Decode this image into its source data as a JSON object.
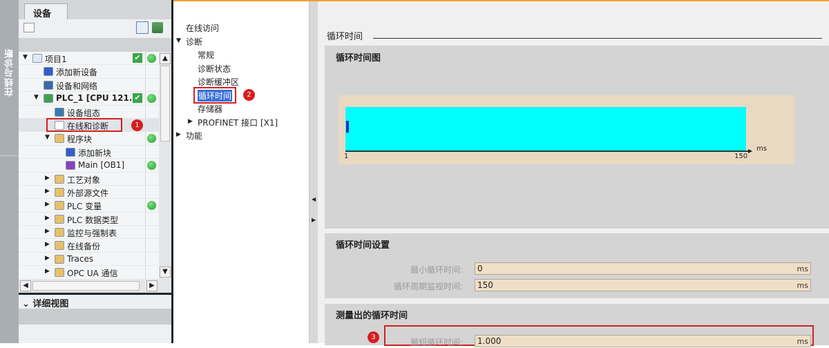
{
  "side_strip": {
    "label": "在线与诊断"
  },
  "project_panel": {
    "tab": "设备",
    "tree": [
      {
        "label": "项目1",
        "indent": 0,
        "expander": "▼",
        "icon_color": "#dfe8f4",
        "check": true,
        "status": true
      },
      {
        "label": "添加新设备",
        "indent": 1,
        "icon_color": "#3060c8"
      },
      {
        "label": "设备和网络",
        "indent": 1,
        "icon_color": "#3a6aa8"
      },
      {
        "label": "PLC_1 [CPU 121...",
        "indent": 1,
        "expander": "▼",
        "icon_color": "#40a050",
        "check": true,
        "status": true,
        "bold": true
      },
      {
        "label": "设备组态",
        "indent": 2,
        "icon_color": "#3a7ab0"
      },
      {
        "label": "在线和诊断",
        "indent": 2,
        "icon_color": "#ffffff",
        "highlight": true,
        "badge": "1"
      },
      {
        "label": "程序块",
        "indent": 2,
        "expander": "▼",
        "icon_color": "#e8c068",
        "status": true
      },
      {
        "label": "添加新块",
        "indent": 3,
        "icon_color": "#3060c8"
      },
      {
        "label": "Main [OB1]",
        "indent": 3,
        "icon_color": "#8a40c0",
        "status": true
      },
      {
        "label": "工艺对象",
        "indent": 2,
        "expander": "▶",
        "icon_color": "#e8c068"
      },
      {
        "label": "外部源文件",
        "indent": 2,
        "expander": "▶",
        "icon_color": "#e8c068"
      },
      {
        "label": "PLC 变量",
        "indent": 2,
        "expander": "▶",
        "icon_color": "#e8c068",
        "status": true
      },
      {
        "label": "PLC 数据类型",
        "indent": 2,
        "expander": "▶",
        "icon_color": "#e8c068"
      },
      {
        "label": "监控与强制表",
        "indent": 2,
        "expander": "▶",
        "icon_color": "#e8c068"
      },
      {
        "label": "在线备份",
        "indent": 2,
        "expander": "▶",
        "icon_color": "#e8c068"
      },
      {
        "label": "Traces",
        "indent": 2,
        "expander": "▶",
        "icon_color": "#e8c068"
      },
      {
        "label": "OPC UA 通信",
        "indent": 2,
        "expander": "▶",
        "icon_color": "#e8c068"
      }
    ],
    "details": "详细视图"
  },
  "nav": {
    "items": [
      {
        "label": "在线访问",
        "level": 0
      },
      {
        "label": "诊断",
        "level": 0,
        "expander": "▼"
      },
      {
        "label": "常规",
        "level": 1
      },
      {
        "label": "诊断状态",
        "level": 1
      },
      {
        "label": "诊断缓冲区",
        "level": 1
      },
      {
        "label": "循环时间",
        "level": 1,
        "selected": true,
        "badge": "2"
      },
      {
        "label": "存储器",
        "level": 1
      },
      {
        "label": "PROFINET 接口 [X1]",
        "level": 1,
        "expander": "▶"
      },
      {
        "label": "功能",
        "level": 0,
        "expander": "▶"
      }
    ]
  },
  "main": {
    "header": "循环时间",
    "chart": {
      "title": "循环时间图",
      "unit": "ms",
      "axis_min": "1",
      "axis_max": "150"
    },
    "settings": {
      "title": "循环时间设置",
      "fields": [
        {
          "label": "最小循环时间:",
          "value": "0",
          "unit": "ms"
        },
        {
          "label": "循环周期监视时间:",
          "value": "150",
          "unit": "ms"
        }
      ]
    },
    "measured": {
      "title": "测量出的循环时间",
      "badge": "3",
      "fields": [
        {
          "label": "最短循环时间:",
          "value": "1.000",
          "unit": "ms"
        }
      ]
    }
  },
  "colors": {
    "accent": "#f0a030",
    "highlight_red": "#d42020",
    "chart_fill": "#00ffff",
    "field_bg": "#efdfc6"
  }
}
